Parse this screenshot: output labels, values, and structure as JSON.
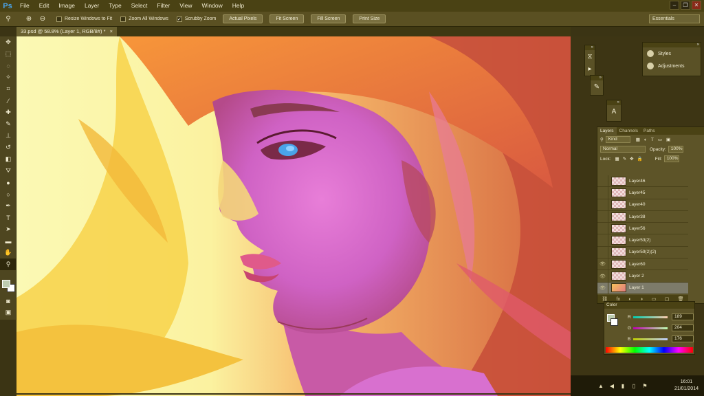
{
  "app": {
    "logo": "Ps"
  },
  "menu": [
    "File",
    "Edit",
    "Image",
    "Layer",
    "Type",
    "Select",
    "Filter",
    "View",
    "Window",
    "Help"
  ],
  "window_controls": [
    "–",
    "❐",
    "✕"
  ],
  "options_bar": {
    "checkboxes": [
      {
        "label": "Resize Windows to Fit",
        "checked": false
      },
      {
        "label": "Zoom All Windows",
        "checked": false
      },
      {
        "label": "Scrubby Zoom",
        "checked": true
      }
    ],
    "buttons": [
      "Actual Pixels",
      "Fit Screen",
      "Fill Screen",
      "Print Size"
    ],
    "workspace": "Essentials"
  },
  "document_tab": "33.psd @ 58.8% (Layer 1, RGB/8#) *",
  "toolbar": {
    "tools": [
      {
        "name": "move",
        "glyph": "✥"
      },
      {
        "name": "marquee",
        "glyph": "⬚"
      },
      {
        "name": "lasso",
        "glyph": "◌"
      },
      {
        "name": "quick-select",
        "glyph": "✧"
      },
      {
        "name": "crop",
        "glyph": "⌗"
      },
      {
        "name": "eyedropper",
        "glyph": "⁄"
      },
      {
        "name": "healing",
        "glyph": "✚"
      },
      {
        "name": "brush",
        "glyph": "✎"
      },
      {
        "name": "clone-stamp",
        "glyph": "⊥"
      },
      {
        "name": "history-brush",
        "glyph": "↺"
      },
      {
        "name": "eraser",
        "glyph": "◧"
      },
      {
        "name": "paint-bucket",
        "glyph": "⛛"
      },
      {
        "name": "blur",
        "glyph": "●"
      },
      {
        "name": "dodge",
        "glyph": "○"
      },
      {
        "name": "pen",
        "glyph": "✒"
      },
      {
        "name": "type",
        "glyph": "T"
      },
      {
        "name": "path-select",
        "glyph": "➤"
      },
      {
        "name": "shape",
        "glyph": "▬"
      },
      {
        "name": "hand",
        "glyph": "✋"
      },
      {
        "name": "zoom",
        "glyph": "⚲"
      }
    ],
    "active_tool": "zoom",
    "extra": [
      {
        "name": "quick-mask",
        "glyph": "◙"
      },
      {
        "name": "screen-mode",
        "glyph": "▣"
      }
    ]
  },
  "styles_panel": {
    "items": [
      "Styles",
      "Adjustments"
    ]
  },
  "layers_panel": {
    "tabs": [
      "Layers",
      "Channels",
      "Paths"
    ],
    "filter": "Kind",
    "blend_mode": "Normal",
    "opacity_label": "Opacity:",
    "opacity": "100%",
    "lock_label": "Lock:",
    "fill_label": "Fill:",
    "fill": "100%",
    "layers": [
      {
        "name": "Layer46",
        "visible": false,
        "painted": false,
        "selected": false
      },
      {
        "name": "Layer45",
        "visible": false,
        "painted": false,
        "selected": false
      },
      {
        "name": "Layer40",
        "visible": false,
        "painted": false,
        "selected": false
      },
      {
        "name": "Layer38",
        "visible": false,
        "painted": false,
        "selected": false
      },
      {
        "name": "Layer56",
        "visible": false,
        "painted": false,
        "selected": false
      },
      {
        "name": "Layer53(2)",
        "visible": false,
        "painted": false,
        "selected": false
      },
      {
        "name": "Layer59(2)(2)",
        "visible": false,
        "painted": false,
        "selected": false
      },
      {
        "name": "Layer60",
        "visible": true,
        "painted": false,
        "selected": false
      },
      {
        "name": "Layer 2",
        "visible": true,
        "painted": false,
        "selected": false
      },
      {
        "name": "Layer 1",
        "visible": true,
        "painted": true,
        "selected": true
      }
    ],
    "footer_icons": [
      "⛓",
      "fx",
      "◐",
      "◑",
      "▭",
      "▢",
      "🗑"
    ]
  },
  "color_panel": {
    "title": "Color",
    "channels": [
      {
        "label": "R",
        "value": "189"
      },
      {
        "label": "G",
        "value": "204"
      },
      {
        "label": "B",
        "value": "176"
      }
    ],
    "foreground": "#bdccb0",
    "background": "#ffffff"
  },
  "taskbar": {
    "time": "16:01",
    "date": "21/01/2014"
  }
}
